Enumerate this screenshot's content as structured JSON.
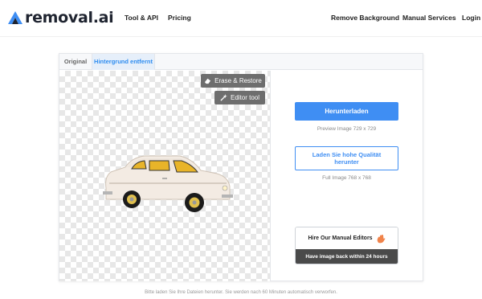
{
  "brand": {
    "logo_text": "removal.ai",
    "accent_color": "#3f8ef3"
  },
  "nav": {
    "left": [
      {
        "label": "Tool & API"
      },
      {
        "label": "Pricing"
      }
    ],
    "right": [
      {
        "label": "Remove Background"
      },
      {
        "label": "Manual Services"
      },
      {
        "label": "Login"
      }
    ]
  },
  "tabs": [
    {
      "label": "Original",
      "active": false
    },
    {
      "label": "Hintergrund entfernt",
      "active": true
    }
  ],
  "preview": {
    "erase_restore_label": "Erase & Restore",
    "erase_icon": "eraser-icon",
    "editor_tool_label": "Editor tool",
    "editor_icon": "magic-wand-icon",
    "subject": "car"
  },
  "download": {
    "primary_label": "Herunterladen",
    "preview_info": "Preview Image   729 x 729",
    "hq_label_line1": "Laden Sie hohe Qualität",
    "hq_label_line2": "herunter",
    "full_info": "Full Image   768 x 768"
  },
  "hire": {
    "title": "Hire Our Manual Editors",
    "icon": "waving-hand-icon",
    "subtitle": "Have image back within 24 hours"
  },
  "footer_note": "Bitte laden Sie Ihre Dateien herunter. Sie werden nach 60 Minuten automatisch verworfen."
}
